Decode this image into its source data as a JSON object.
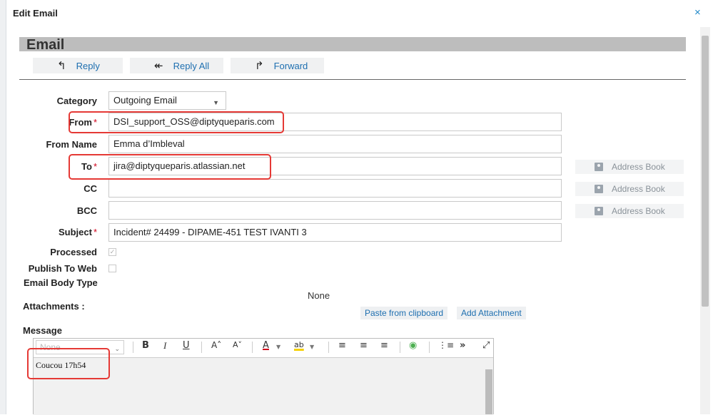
{
  "dialog": {
    "title": "Edit Email",
    "close": "×"
  },
  "section": {
    "title": "Email"
  },
  "toolbar": {
    "reply": {
      "icon": "↰",
      "label": "Reply"
    },
    "reply_all": {
      "icon": "↞",
      "label": "Reply All"
    },
    "forward": {
      "icon": "↱",
      "label": "Forward"
    }
  },
  "form": {
    "category": {
      "label": "Category",
      "value": "Outgoing Email",
      "caret": "▼"
    },
    "from": {
      "label": "From",
      "req": "*",
      "value": "DSI_support_OSS@diptyqueparis.com"
    },
    "from_name": {
      "label": "From Name",
      "value": "Emma d’Imbleval"
    },
    "to": {
      "label": "To",
      "req": "*",
      "value": "jira@diptyqueparis.atlassian.net"
    },
    "cc": {
      "label": "CC",
      "value": ""
    },
    "bcc": {
      "label": "BCC",
      "value": ""
    },
    "subject": {
      "label": "Subject",
      "req": "*",
      "value": "Incident# 24499 - DIPAME-451 TEST IVANTI 3"
    },
    "processed": {
      "label": "Processed",
      "checked": true,
      "mark": "✓"
    },
    "publish": {
      "label": "Publish To Web",
      "checked": false
    },
    "body_type": {
      "label": "Email Body Type"
    }
  },
  "address_book": {
    "label": "Address Book",
    "icon": "address-book-icon"
  },
  "attachments": {
    "label": "Attachments :",
    "none_text": "None",
    "paste": "Paste from clipboard",
    "add": "Add Attachment"
  },
  "message": {
    "label": "Message",
    "format_select": "None",
    "caret": "⌄",
    "tools": {
      "bold": "B",
      "italic": "I",
      "underline": "U",
      "grow": "A˄",
      "shrink": "A˅",
      "font_color": "A",
      "highlight": "ab",
      "align_left": "≡",
      "align_center": "≡",
      "align_right": "≡",
      "insert": "◉",
      "list": "⋮≡",
      "more": "»",
      "expand": "⤢"
    },
    "body": "Coucou 17h54"
  },
  "colors": {
    "accent": "#1e6fb0",
    "required": "#d0021b",
    "highlight_box": "#e53935"
  }
}
